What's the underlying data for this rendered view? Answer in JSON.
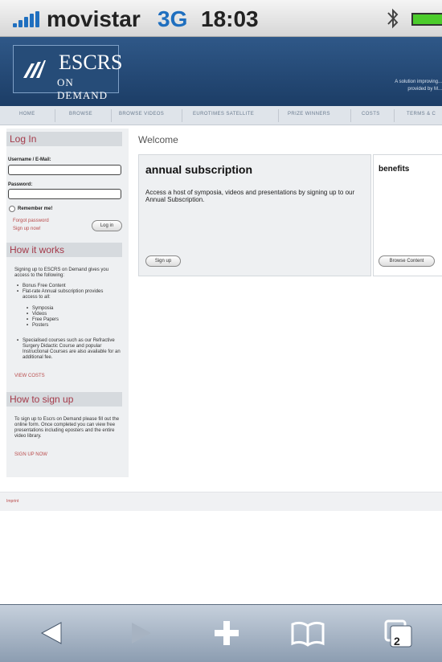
{
  "status_bar": {
    "carrier": "movistar",
    "network": "3G",
    "time": "18:03",
    "battery_color": "#4ccc2c"
  },
  "header": {
    "logo_title": "ESCRS",
    "logo_subtitle": "ON DEMAND",
    "tagline": "A solution improving... provided by M..."
  },
  "nav": {
    "items": [
      "HOME",
      "BROWSE",
      "BROWSE VIDEOS",
      "EUROTIMES SATELLITE",
      "PRIZE WINNERS",
      "COSTS",
      "TERMS & C"
    ]
  },
  "sidebar": {
    "login": {
      "heading": "Log In",
      "username_label": "Username / E-Mail:",
      "password_label": "Password:",
      "remember_label": "Remember me!",
      "forgot_link": "Forgot password",
      "signup_link": "Sign up now!",
      "login_button": "Log in"
    },
    "how_it_works": {
      "heading": "How it works",
      "intro": "Signing up to ESCRS on Demand gives you access to the following:",
      "bullets": [
        "Bonus Free Content",
        "Flat-rate Annual subscription provides access to all:"
      ],
      "sub_bullets": [
        "Symposia",
        "Videos",
        "Free Papers",
        "Posters"
      ],
      "extra": "Specialised courses such as our Refractive Surgery Didactic Course and popular Instructional Courses are also available for an additional fee.",
      "link": "VIEW COSTS"
    },
    "how_to_sign_up": {
      "heading": "How to sign up",
      "text": "To sign up to Escrs on Demand please fill out the online form. Once completed you can view free presentations including eposters and the entire video library.",
      "link": "SIGN UP NOW"
    }
  },
  "main": {
    "welcome": "Welcome",
    "subscription": {
      "title": "annual subscription",
      "description": "Access a host of symposia, videos and presentations by signing up to our Annual Subscription.",
      "button": "Sign up"
    },
    "benefits": {
      "title": "benefits",
      "button": "Browse Content"
    }
  },
  "footer": {
    "link": "Imprint"
  },
  "toolbar": {
    "tab_count": "2"
  }
}
